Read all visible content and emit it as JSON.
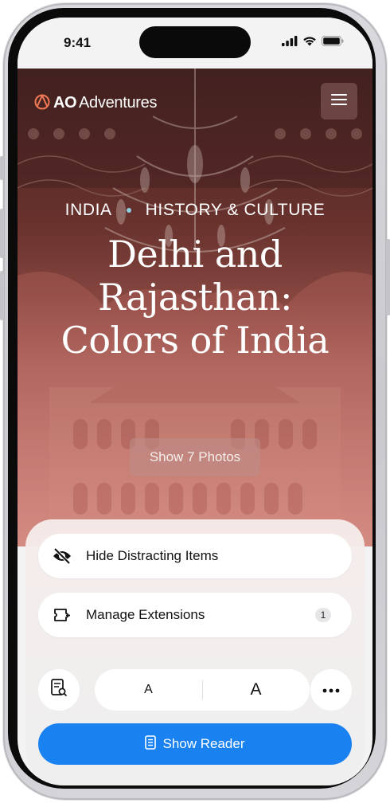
{
  "status_bar": {
    "time": "9:41"
  },
  "site": {
    "logo_mark": "AO",
    "logo_text": "Adventures",
    "kicker_left": "INDIA",
    "kicker_right": "HISTORY & CULTURE",
    "headline": "Delhi and Rajasthan: Colors of India",
    "photos_button": "Show 7 Photos"
  },
  "sheet": {
    "hide_distracting": {
      "label": "Hide Distracting Items",
      "icon": "eye-slash-icon"
    },
    "manage_extensions": {
      "label": "Manage Extensions",
      "count": "1",
      "icon": "extension-icon"
    },
    "font_small": "A",
    "font_large": "A",
    "reader_button": "Show Reader"
  },
  "colors": {
    "accent": "#1a82f0",
    "kicker_dot": "#8fd0e0"
  }
}
